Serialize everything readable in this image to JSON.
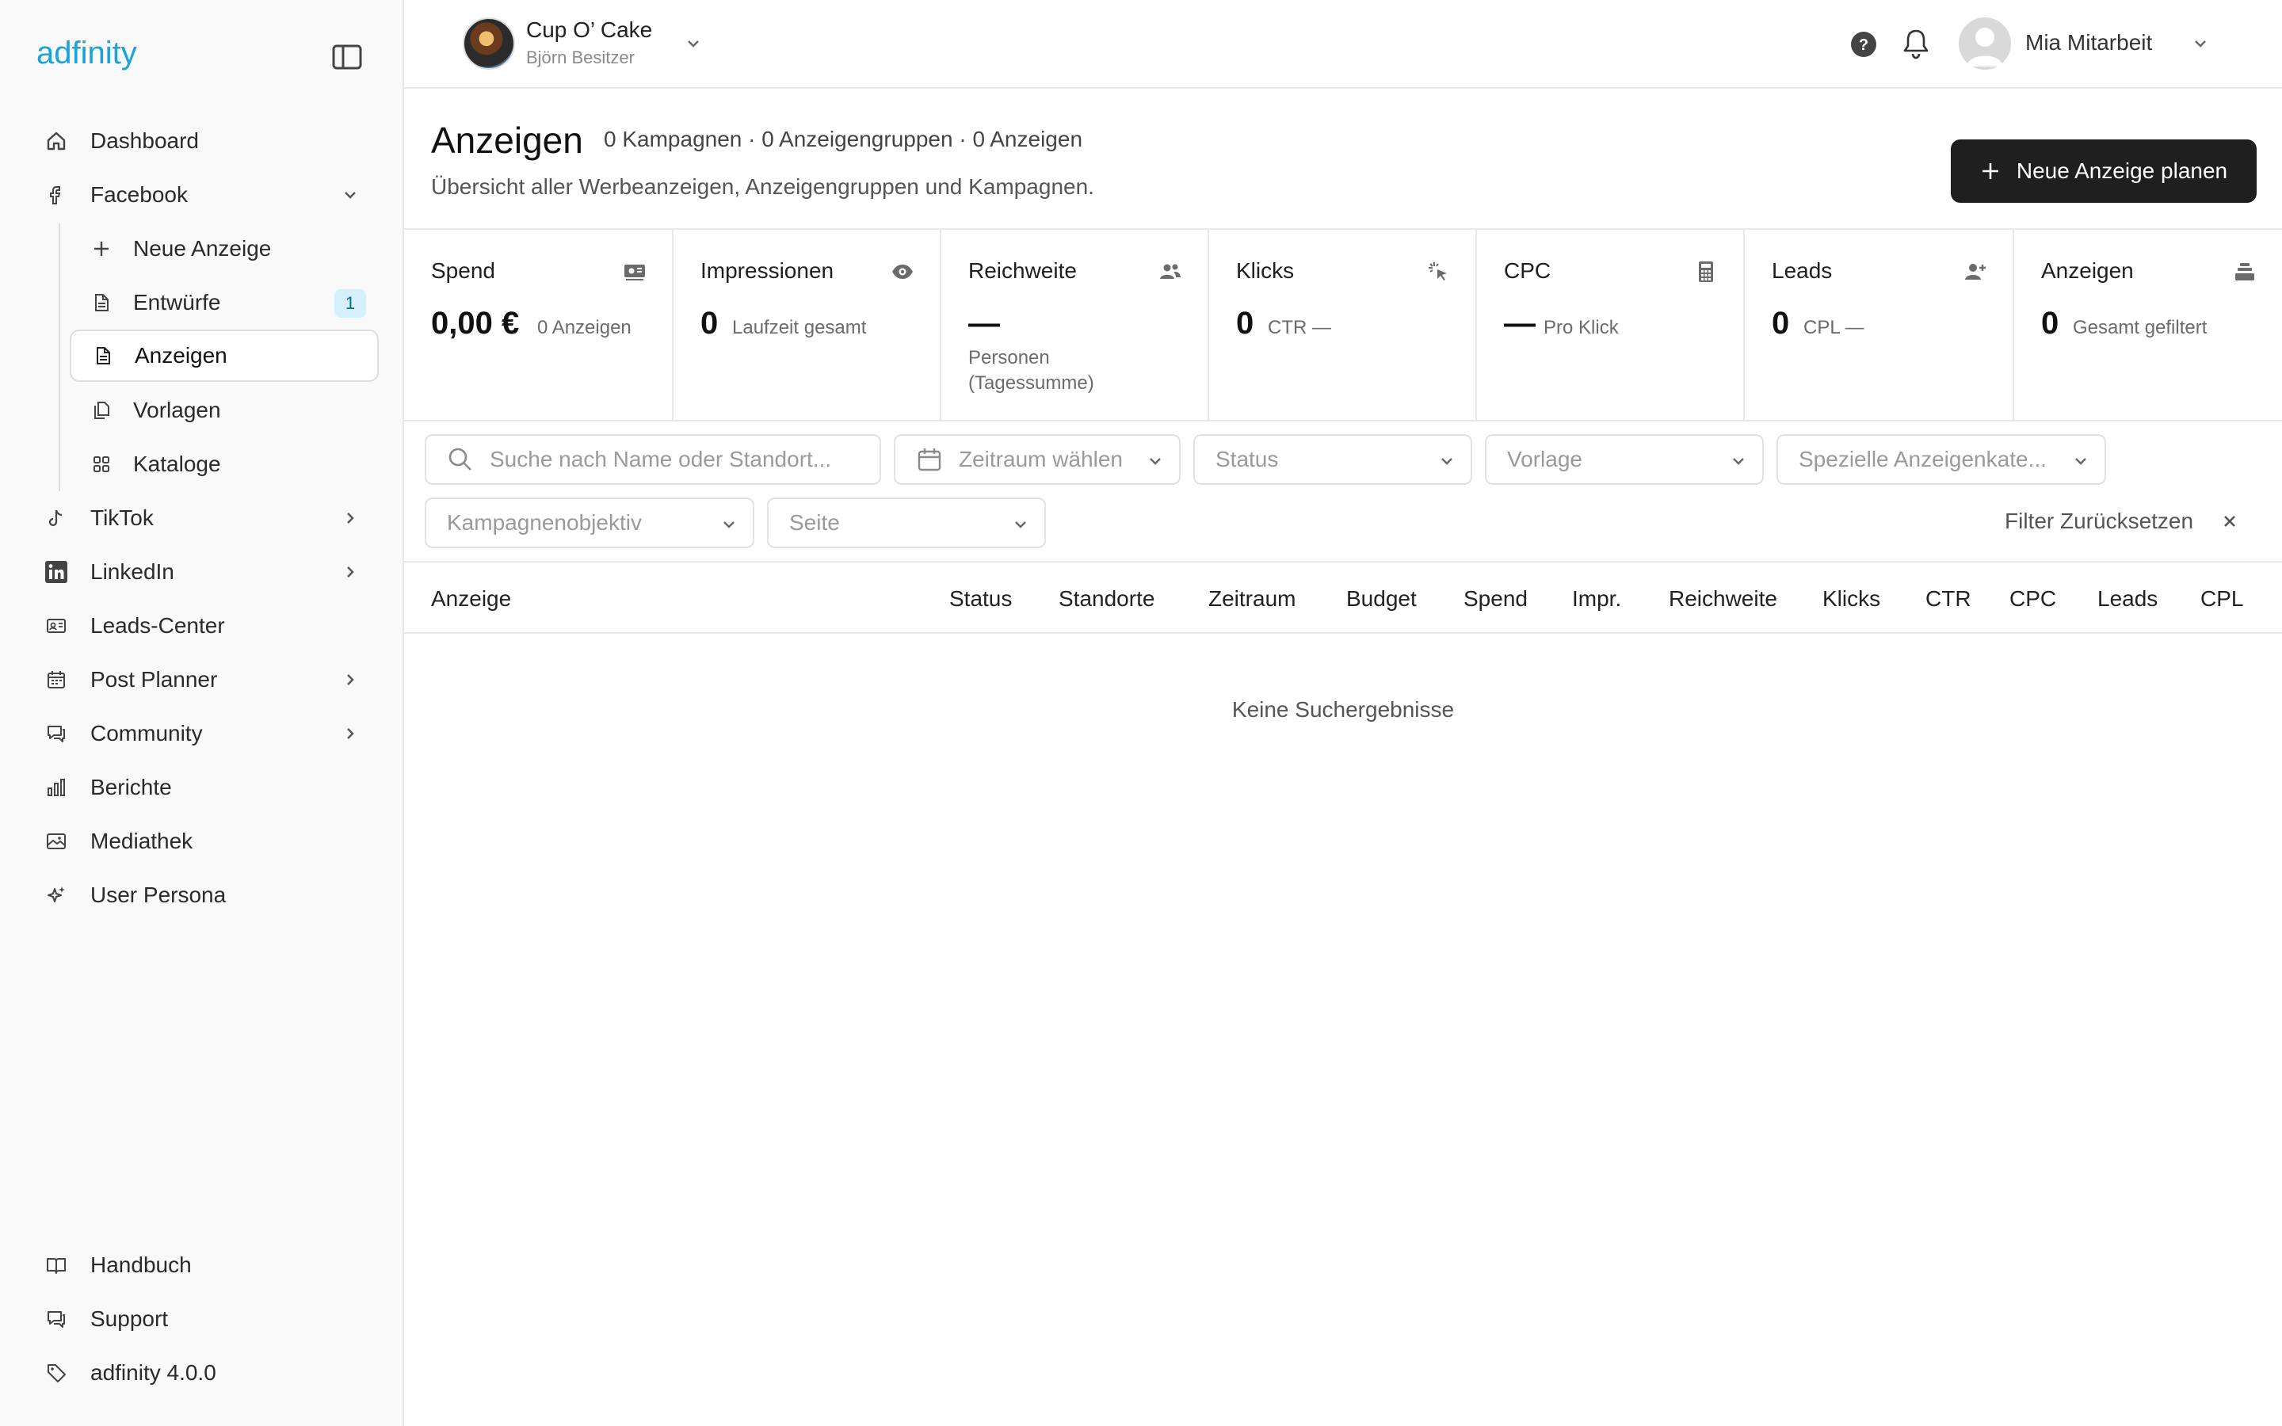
{
  "app": {
    "logo_text": "adfinity",
    "brand_color": "#1aa3d9"
  },
  "sidebar": {
    "items": {
      "dashboard": "Dashboard",
      "facebook": "Facebook",
      "tiktok": "TikTok",
      "linkedin": "LinkedIn",
      "leads_center": "Leads-Center",
      "post_planner": "Post Planner",
      "community": "Community",
      "berichte": "Berichte",
      "mediathek": "Mediathek",
      "user_persona": "User Persona"
    },
    "facebook_sub": {
      "neue_anzeige": "Neue Anzeige",
      "entwuerfe": "Entwürfe",
      "entwuerfe_badge": "1",
      "anzeigen": "Anzeigen",
      "vorlagen": "Vorlagen",
      "kataloge": "Kataloge"
    },
    "bottom": {
      "handbuch": "Handbuch",
      "support": "Support",
      "version": "adfinity 4.0.0"
    }
  },
  "header": {
    "brand_name": "Cup O’ Cake",
    "brand_owner": "Björn Besitzer",
    "user_name": "Mia Mitarbeit"
  },
  "page": {
    "title": "Anzeigen",
    "counts": "0 Kampagnen · 0 Anzeigengruppen · 0 Anzeigen",
    "subtitle": "Übersicht aller Werbeanzeigen, Anzeigengruppen und Kampagnen.",
    "primary_button": "Neue Anzeige planen"
  },
  "stats": {
    "spend": {
      "title": "Spend",
      "value": "0,00 €",
      "sub": "0 Anzeigen",
      "icon": "money-icon"
    },
    "impressionen": {
      "title": "Impressionen",
      "value": "0",
      "sub": "Laufzeit gesamt",
      "icon": "eye-icon"
    },
    "reichweite": {
      "title": "Reichweite",
      "value": "—",
      "sub": "Personen (Tagessumme)",
      "icon": "users-icon"
    },
    "klicks": {
      "title": "Klicks",
      "value": "0",
      "sub": "CTR —",
      "icon": "click-icon"
    },
    "cpc": {
      "title": "CPC",
      "value": "—",
      "sub": "Pro Klick",
      "icon": "calculator-icon"
    },
    "leads": {
      "title": "Leads",
      "value": "0",
      "sub": "CPL —",
      "icon": "user-plus-icon"
    },
    "anzeigen": {
      "title": "Anzeigen",
      "value": "0",
      "sub": "Gesamt gefiltert",
      "icon": "stack-icon"
    }
  },
  "filters": {
    "search_placeholder": "Suche nach Name oder Standort...",
    "zeitraum": "Zeitraum wählen",
    "status": "Status",
    "vorlage": "Vorlage",
    "kategorie": "Spezielle Anzeigenkate...",
    "objektiv": "Kampagnenobjektiv",
    "seite": "Seite",
    "reset": "Filter Zurücksetzen"
  },
  "table": {
    "columns": [
      "Anzeige",
      "Status",
      "Standorte",
      "Zeitraum",
      "Budget",
      "Spend",
      "Impr.",
      "Reichweite",
      "Klicks",
      "CTR",
      "CPC",
      "Leads",
      "CPL"
    ],
    "empty_text": "Keine Suchergebnisse"
  }
}
